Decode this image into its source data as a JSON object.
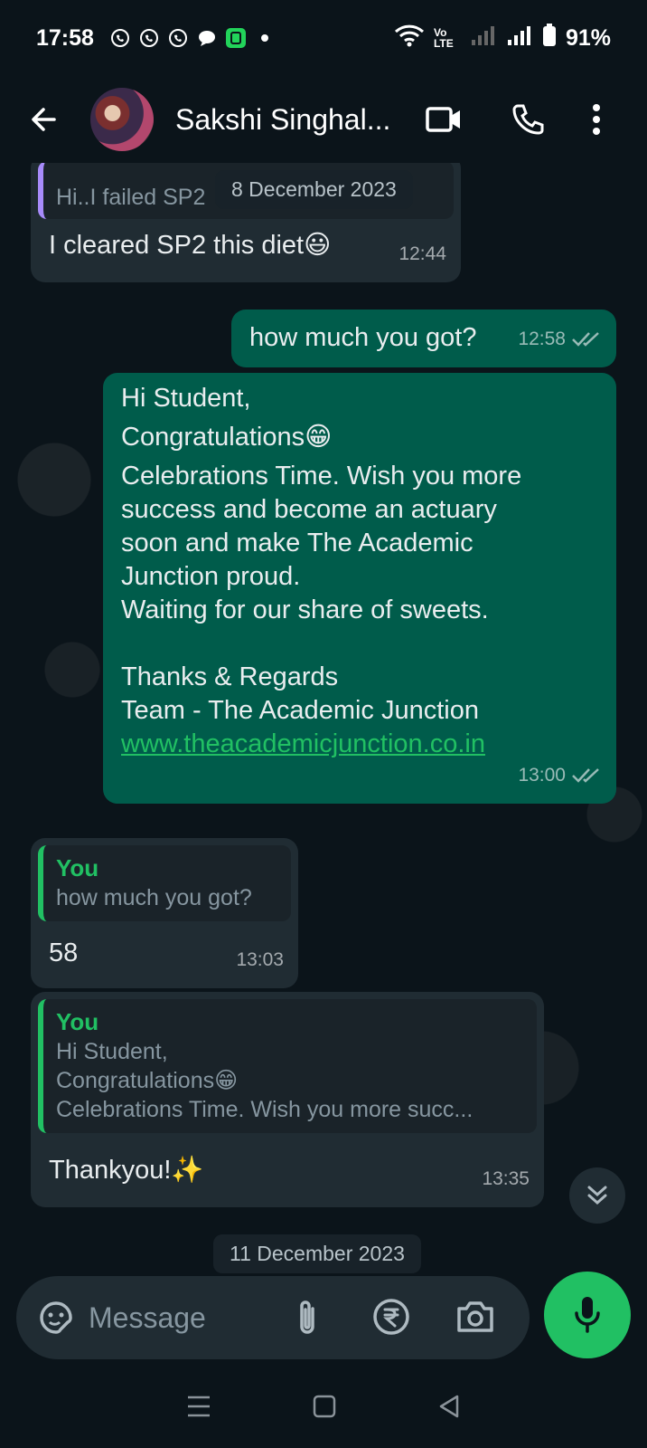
{
  "status_bar": {
    "time": "17:58",
    "network": "Vo LTE",
    "battery": "91%"
  },
  "header": {
    "contact_name": "Sakshi Singhal..."
  },
  "messages": {
    "m1": {
      "quoted_text": "Hi..I failed SP2",
      "text": "I cleared SP2 this diet😃",
      "time": "12:44"
    },
    "m2": {
      "text": "how much you got?",
      "time": "12:58"
    },
    "m3": {
      "line1": "Hi Student,",
      "line2": "Congratulations😁",
      "line3": "Celebrations Time. Wish you more",
      "line4": "success and become an actuary",
      "line5": "soon and make The Academic",
      "line6": "Junction proud.",
      "line7": "Waiting for our share of sweets.",
      "line8": "Thanks & Regards",
      "line9": "Team - The Academic Junction",
      "link": "www.theacademicjunction.co.in",
      "time": "13:00"
    },
    "m4": {
      "quote_author": "You",
      "quote_text": "how much you got?",
      "text": "58",
      "time": "13:03"
    },
    "m5": {
      "quote_author": "You",
      "quote_line1": "Hi Student,",
      "quote_line2": "Congratulations😁",
      "quote_line3": "Celebrations Time. Wish you more succ...",
      "text": "Thankyou!✨",
      "time": "13:35"
    }
  },
  "date_chips": {
    "top": "8 December 2023",
    "bottom": "11 December 2023"
  },
  "input": {
    "placeholder": "Message"
  },
  "colors": {
    "accent": "#21c063",
    "outgoing": "#005c4b",
    "incoming": "#202c33",
    "background": "#0b141a"
  }
}
